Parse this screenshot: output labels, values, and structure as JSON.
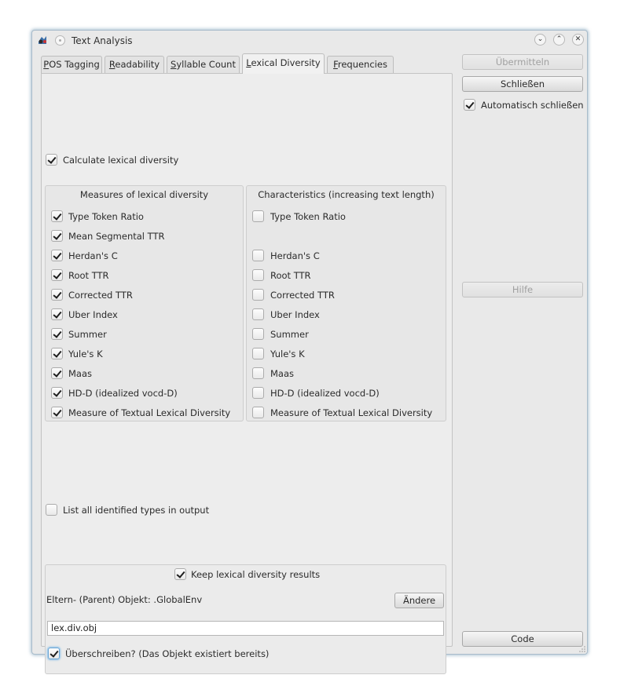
{
  "window": {
    "title": "Text Analysis"
  },
  "tabs": [
    {
      "label": "POS Tagging",
      "mnemonic": "P",
      "rest": "OS Tagging"
    },
    {
      "label": "Readability",
      "mnemonic": "R",
      "rest": "eadability"
    },
    {
      "label": "Syllable Count",
      "mnemonic": "S",
      "rest": "yllable Count"
    },
    {
      "label": "Lexical Diversity",
      "mnemonic": "L",
      "rest": "exical Diversity"
    },
    {
      "label": "Frequencies",
      "mnemonic": "F",
      "rest": "requencies"
    }
  ],
  "active_tab": "Lexical Diversity",
  "calculate": {
    "label": "Calculate lexical diversity",
    "checked": true
  },
  "measures_group": {
    "title": "Measures of lexical diversity",
    "items": [
      {
        "label": "Type Token Ratio",
        "checked": true
      },
      {
        "label": "Mean Segmental TTR",
        "checked": true
      },
      {
        "label": "Herdan's C",
        "checked": true
      },
      {
        "label": "Root TTR",
        "checked": true
      },
      {
        "label": "Corrected TTR",
        "checked": true
      },
      {
        "label": "Uber Index",
        "checked": true
      },
      {
        "label": "Summer",
        "checked": true
      },
      {
        "label": "Yule's K",
        "checked": true
      },
      {
        "label": "Maas",
        "checked": true
      },
      {
        "label": "HD-D (idealized vocd-D)",
        "checked": true
      },
      {
        "label": "Measure of Textual Lexical Diversity",
        "checked": true
      }
    ]
  },
  "characteristics_group": {
    "title": "Characteristics (increasing text length)",
    "items": [
      {
        "label": "Type Token Ratio",
        "checked": false
      },
      {
        "label": "Herdan's C",
        "checked": false
      },
      {
        "label": "Root TTR",
        "checked": false
      },
      {
        "label": "Corrected TTR",
        "checked": false
      },
      {
        "label": "Uber Index",
        "checked": false
      },
      {
        "label": "Summer",
        "checked": false
      },
      {
        "label": "Yule's K",
        "checked": false
      },
      {
        "label": "Maas",
        "checked": false
      },
      {
        "label": "HD-D (idealized vocd-D)",
        "checked": false
      },
      {
        "label": "Measure of Textual Lexical Diversity",
        "checked": false
      }
    ]
  },
  "list_types": {
    "label": "List all identified types in output",
    "checked": false
  },
  "save_group": {
    "keep_label": "Keep lexical diversity results",
    "keep_checked": true,
    "parent_label": "Eltern- (Parent) Objekt: .GlobalEnv",
    "change_button": "Ändere",
    "object_name": "lex.div.obj",
    "overwrite_label": "Überschreiben? (Das Objekt existiert bereits)",
    "overwrite_checked": true
  },
  "side": {
    "submit": "Übermitteln",
    "close": "Schließen",
    "auto_close_label": "Automatisch schließen",
    "auto_close_checked": true,
    "help": "Hilfe",
    "code": "Code"
  },
  "colors": {
    "window_border": "#a9bccb",
    "panel_bg": "#ededed",
    "focus": "#6aa6d6"
  },
  "icons": [
    "app-icon",
    "pin-icon",
    "minimize-icon",
    "maximize-icon",
    "close-icon",
    "checkmark-icon",
    "resize-grip-icon"
  ]
}
